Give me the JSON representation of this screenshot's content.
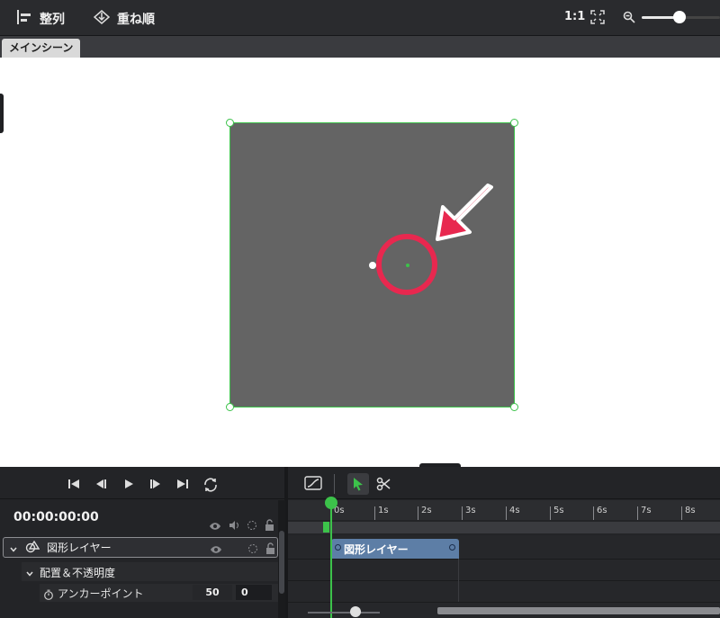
{
  "toolbar": {
    "align_label": "整列",
    "order_label": "重ね順",
    "ratio_label": "1:1",
    "zoom_level": 0.35
  },
  "tabs": [
    {
      "label": "メインシーン",
      "active": true
    }
  ],
  "colors": {
    "accent": "#3cc24a",
    "highlight": "#e8284f",
    "clip": "#5d7ea6",
    "shape_fill": "#646464"
  },
  "icons": [
    "align-icon",
    "layer-order-icon",
    "fit-screen-icon",
    "zoom-icon",
    "skip-start-icon",
    "step-back-icon",
    "play-icon",
    "step-forward-icon",
    "skip-end-icon",
    "loop-icon",
    "easing-curve-icon",
    "select-tool-icon",
    "cut-tool-icon",
    "eye-icon",
    "speaker-icon",
    "solo-icon",
    "lock-icon",
    "shape-layer-icon",
    "stopwatch-icon"
  ],
  "timeline": {
    "timecode": "00:00:00:00",
    "ruler_labels": [
      "0s",
      "1s",
      "2s",
      "3s",
      "4s",
      "5s",
      "6s",
      "7s",
      "8s"
    ]
  },
  "layers": [
    {
      "name": "図形レイヤー",
      "clip_label": "図形レイヤー",
      "group": {
        "name": "配置＆不透明度",
        "property": {
          "name": "アンカーポイント",
          "x": "50",
          "y": "0"
        }
      }
    }
  ]
}
